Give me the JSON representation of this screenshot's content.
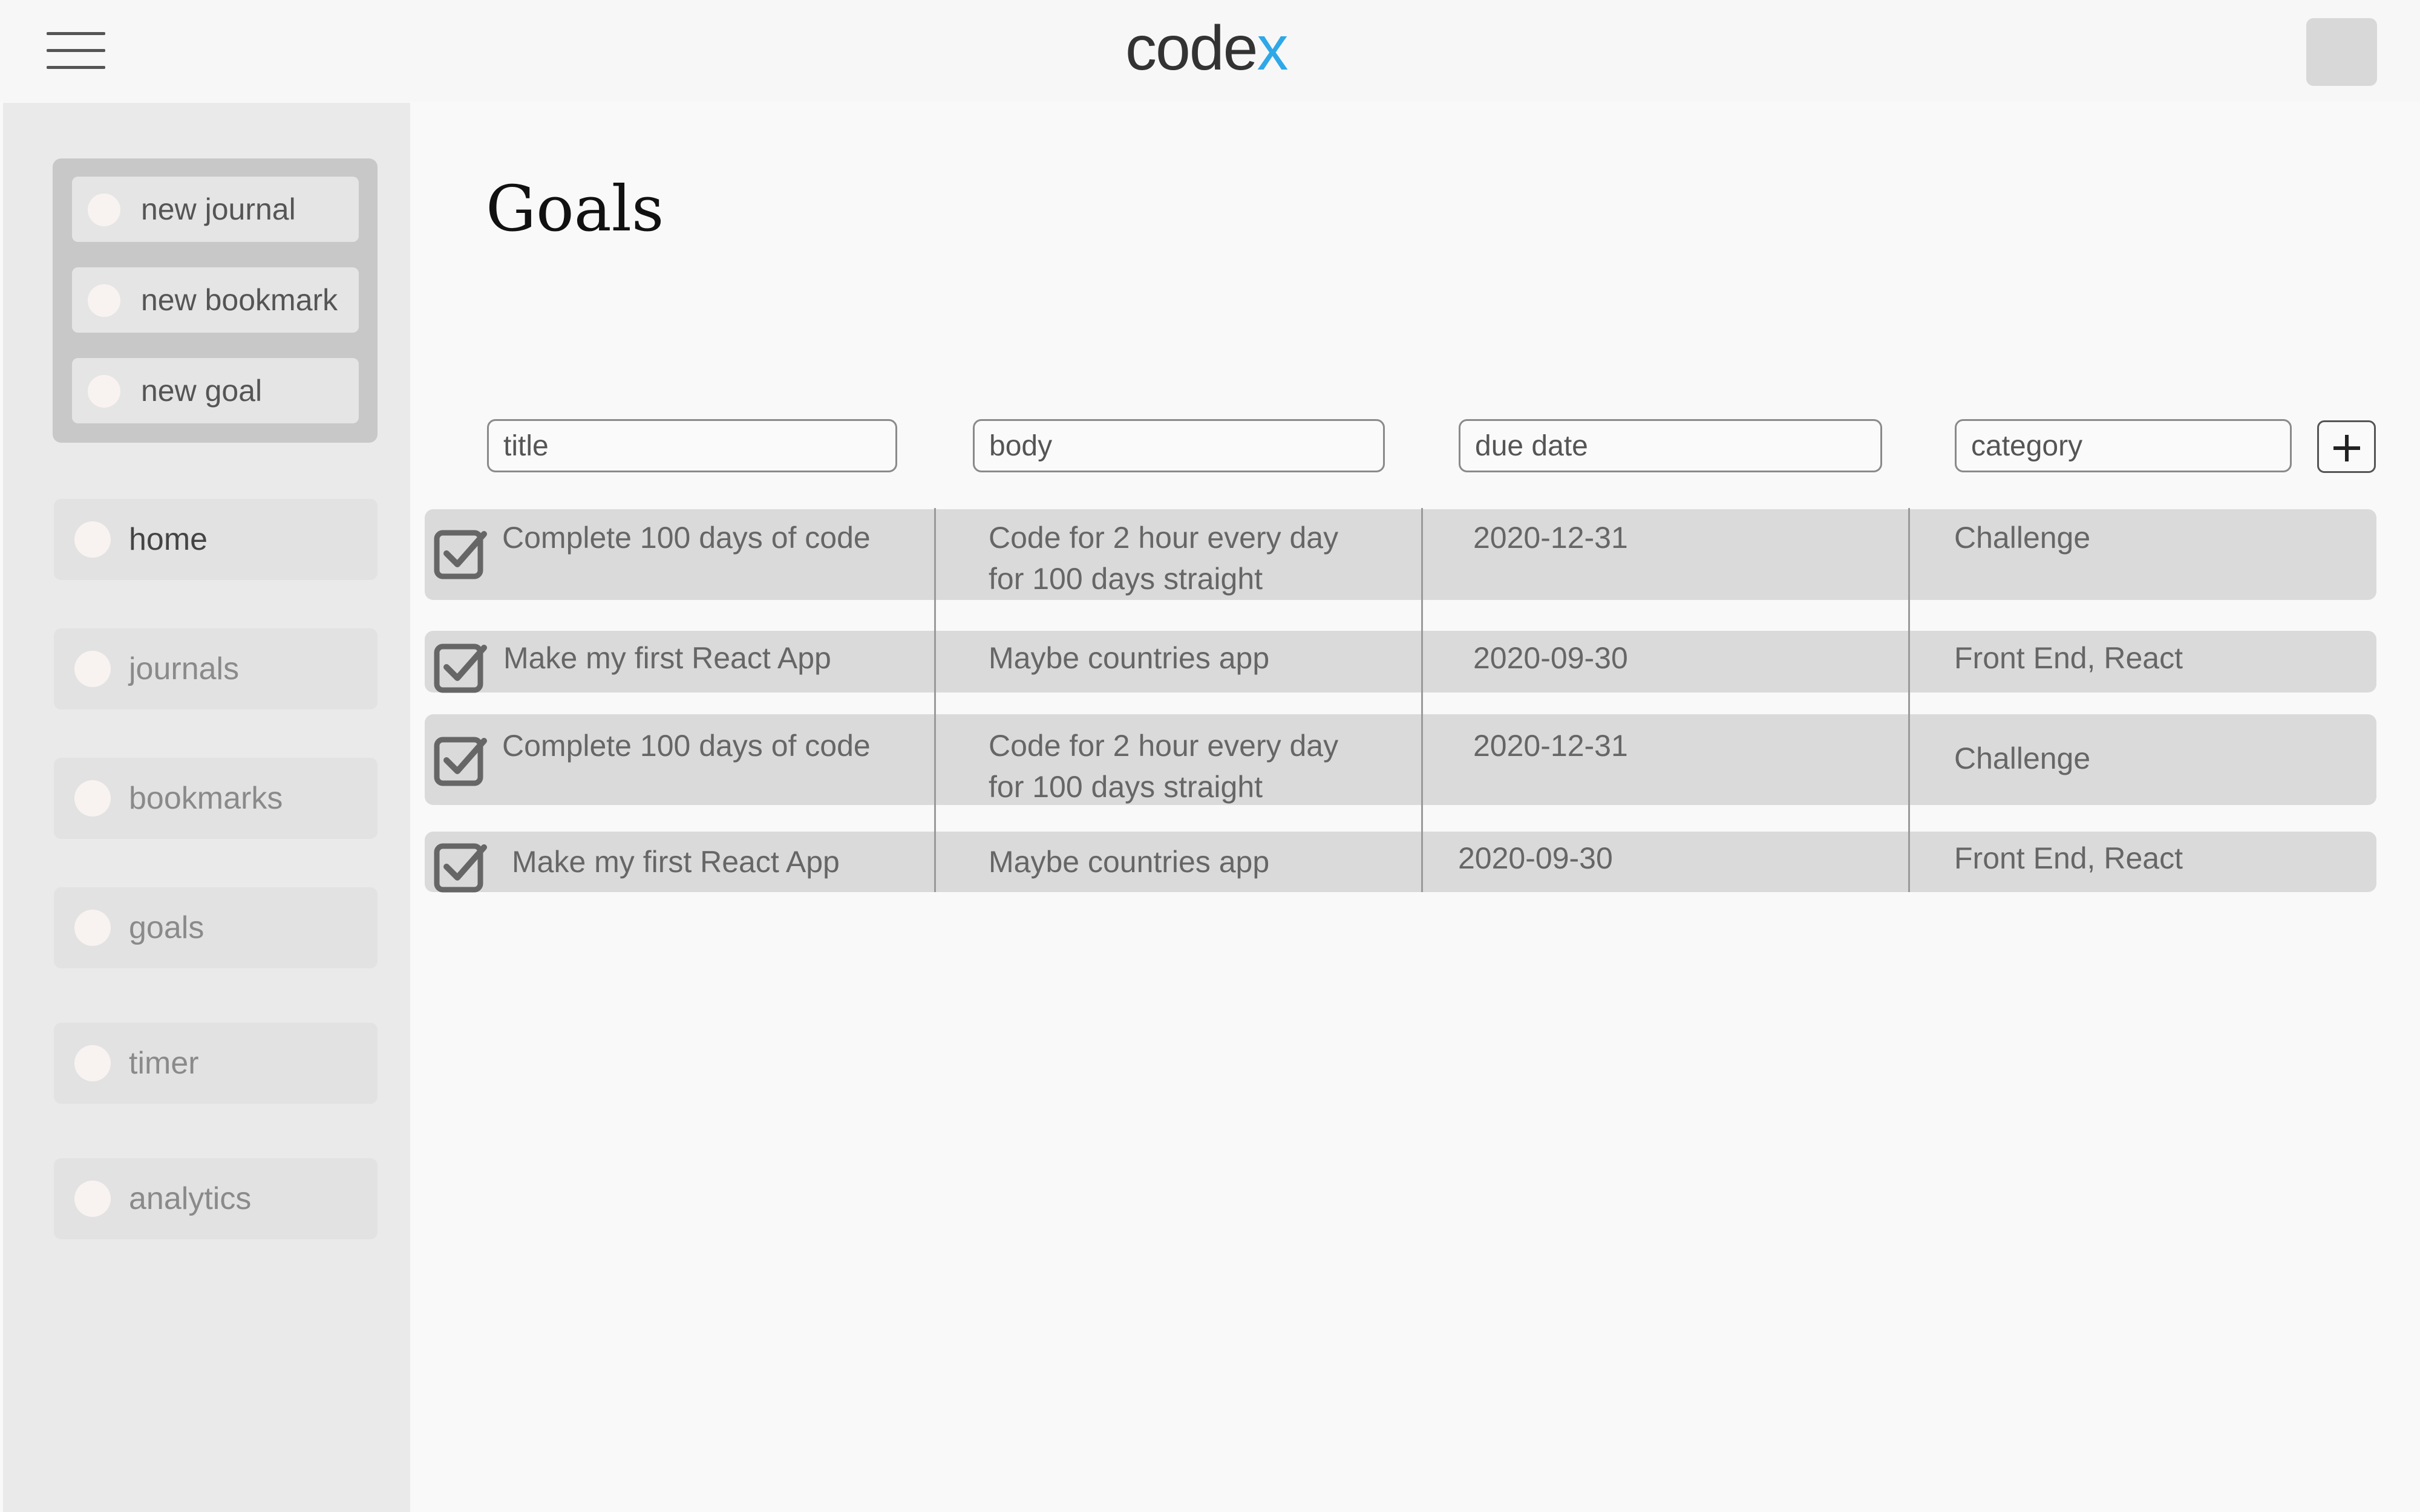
{
  "header": {
    "logo_main": "code",
    "logo_accent": "x"
  },
  "quick_actions": [
    {
      "label": "new journal"
    },
    {
      "label": "new bookmark"
    },
    {
      "label": "new goal"
    }
  ],
  "nav": [
    {
      "label": "home",
      "active": true
    },
    {
      "label": "journals"
    },
    {
      "label": "bookmarks"
    },
    {
      "label": "goals"
    },
    {
      "label": "timer"
    },
    {
      "label": "analytics"
    }
  ],
  "page": {
    "title": "Goals"
  },
  "filters": {
    "title_placeholder": "title",
    "body_placeholder": "body",
    "due_date_placeholder": "due date",
    "category_placeholder": "category"
  },
  "goals": [
    {
      "title": "Complete 100 days of code",
      "body": "Code for 2 hour every day for 100 days straight",
      "due_date": "2020-12-31",
      "category": "Challenge",
      "checked": true
    },
    {
      "title": "Make my first React App",
      "body": "Maybe countries app",
      "due_date": "2020-09-30",
      "category": "Front End, React",
      "checked": true
    },
    {
      "title": "Complete 100 days of code",
      "body": "Code for 2 hour every day for 100 days straight",
      "due_date": "2020-12-31",
      "category": "Challenge",
      "checked": true
    },
    {
      "title": "Make my first React App",
      "body": "Maybe countries app",
      "due_date": "2020-09-30",
      "category": "Front End, React",
      "checked": true
    }
  ],
  "colors": {
    "accent": "#2ea8e8",
    "row_bg": "#dadada",
    "sidebar_bg": "#eaeaea"
  },
  "icons": {
    "menu": "hamburger-icon",
    "add": "plus-icon",
    "check": "checkbox-checked-icon"
  }
}
